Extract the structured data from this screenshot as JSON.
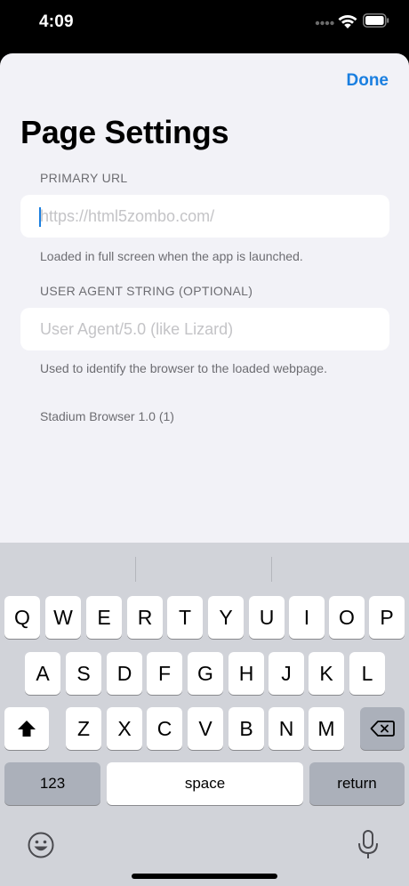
{
  "status_bar": {
    "time": "4:09",
    "icons": [
      "cellular-dots-icon",
      "wifi-icon",
      "battery-icon"
    ]
  },
  "header": {
    "done_label": "Done",
    "title": "Page Settings"
  },
  "sections": [
    {
      "header": "PRIMARY URL",
      "value": "",
      "placeholder": "https://html5zombo.com/",
      "footer": "Loaded in full screen when the app is launched."
    },
    {
      "header": "USER AGENT STRING (OPTIONAL)",
      "value": "",
      "placeholder": "User Agent/5.0 (like Lizard)",
      "footer": "Used to identify the browser to the loaded webpage."
    }
  ],
  "version": "Stadium Browser 1.0 (1)",
  "keyboard": {
    "row1": [
      "Q",
      "W",
      "E",
      "R",
      "T",
      "Y",
      "U",
      "I",
      "O",
      "P"
    ],
    "row2": [
      "A",
      "S",
      "D",
      "F",
      "G",
      "H",
      "J",
      "K",
      "L"
    ],
    "row3": [
      "Z",
      "X",
      "C",
      "V",
      "B",
      "N",
      "M"
    ],
    "numbers_label": "123",
    "space_label": "space",
    "return_label": "return",
    "icons": [
      "shift-icon",
      "backspace-icon",
      "emoji-icon",
      "microphone-icon"
    ]
  },
  "colors": {
    "accent": "#1a7fe0",
    "background": "#f2f2f7",
    "keyboard": "#d1d3d9"
  }
}
